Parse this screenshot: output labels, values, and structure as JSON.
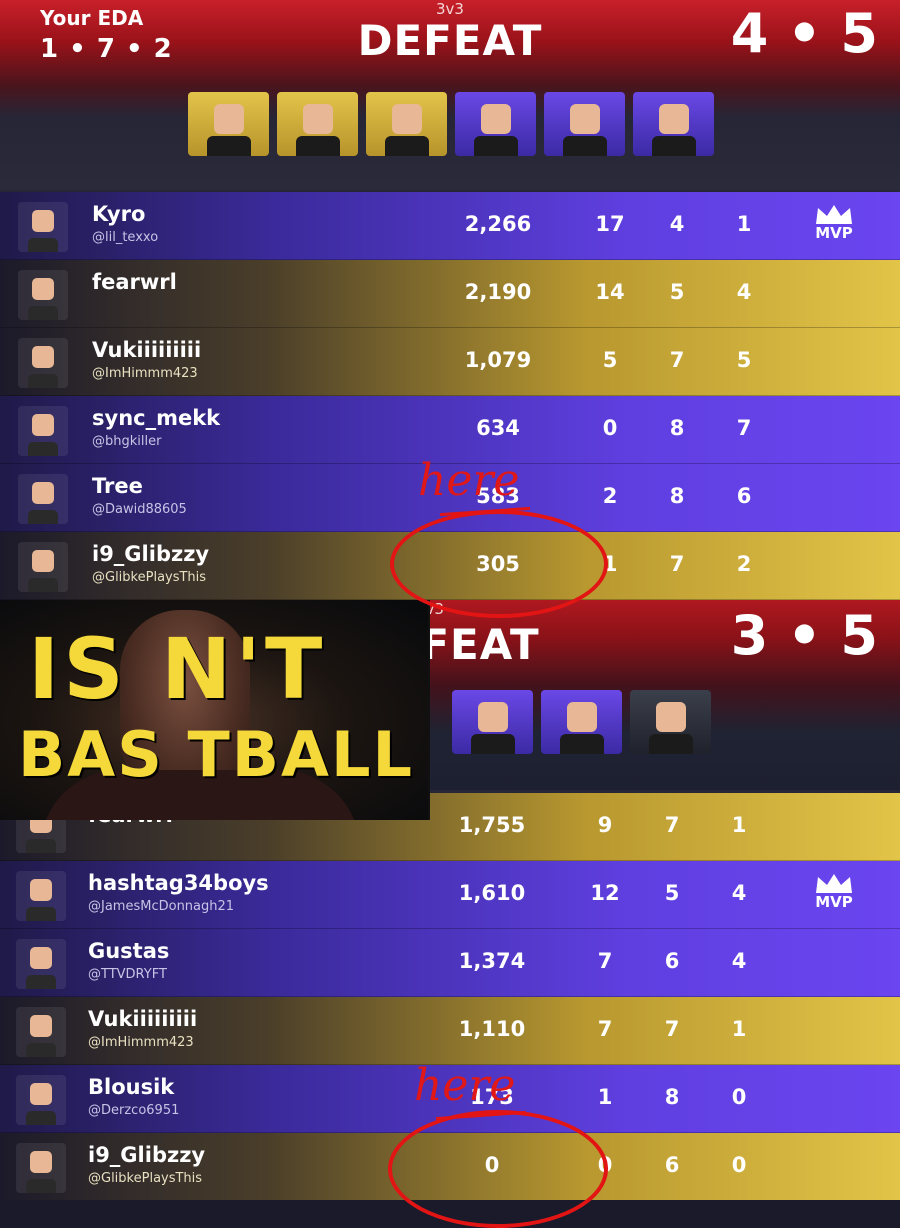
{
  "colors": {
    "banner_red": "#c8202a",
    "row_purple": "#6a45f0",
    "row_gold": "#e2c448",
    "annotation_red": "#e21414",
    "thumb_text": "#f5d93a"
  },
  "match1": {
    "team_label": "Your EDA",
    "team_score": "1 • 7 • 2",
    "mode": "3v3",
    "result": "DEFEAT",
    "score": "4 • 5",
    "avatars": [
      "gold",
      "gold",
      "gold",
      "purple",
      "purple",
      "purple"
    ],
    "rows": [
      {
        "color": "purple",
        "name": "Kyro",
        "handle": "@lil_texxo",
        "points": "2,266",
        "k": "17",
        "d": "4",
        "a": "1",
        "mvp": true
      },
      {
        "color": "gold",
        "name": "fearwrl",
        "handle": "",
        "points": "2,190",
        "k": "14",
        "d": "5",
        "a": "4",
        "mvp": false
      },
      {
        "color": "gold",
        "name": "Vukiiiiiiiii",
        "handle": "@ImHimmm423",
        "points": "1,079",
        "k": "5",
        "d": "7",
        "a": "5",
        "mvp": false
      },
      {
        "color": "purple",
        "name": "sync_mekk",
        "handle": "@bhgkiller",
        "points": "634",
        "k": "0",
        "d": "8",
        "a": "7",
        "mvp": false
      },
      {
        "color": "purple",
        "name": "Tree",
        "handle": "@Dawid88605",
        "points": "583",
        "k": "2",
        "d": "8",
        "a": "6",
        "mvp": false
      },
      {
        "color": "gold",
        "name": "i9_Glibzzy",
        "handle": "@GlibkePlaysThis",
        "points": "305",
        "k": "1",
        "d": "7",
        "a": "2",
        "mvp": false
      }
    ]
  },
  "match2": {
    "mode": "3v3",
    "result": "FEAT",
    "score": "3 • 5",
    "avatars": [
      "purple",
      "purple",
      "dark"
    ],
    "rows": [
      {
        "color": "gold",
        "name": "fearwrl",
        "handle": "",
        "points": "1,755",
        "k": "9",
        "d": "7",
        "a": "1",
        "mvp": false
      },
      {
        "color": "purple",
        "name": "hashtag34boys",
        "handle": "@JamesMcDonnagh21",
        "points": "1,610",
        "k": "12",
        "d": "5",
        "a": "4",
        "mvp": true
      },
      {
        "color": "purple",
        "name": "Gustas",
        "handle": "@TTVDRYFT",
        "points": "1,374",
        "k": "7",
        "d": "6",
        "a": "4",
        "mvp": false
      },
      {
        "color": "gold",
        "name": "Vukiiiiiiiii",
        "handle": "@ImHimmm423",
        "points": "1,110",
        "k": "7",
        "d": "7",
        "a": "1",
        "mvp": false
      },
      {
        "color": "purple",
        "name": "Blousik",
        "handle": "@Derzco6951",
        "points": "173",
        "k": "1",
        "d": "8",
        "a": "0",
        "mvp": false
      },
      {
        "color": "gold",
        "name": "i9_Glibzzy",
        "handle": "@GlibkePlaysThis",
        "points": "0",
        "k": "0",
        "d": "6",
        "a": "0",
        "mvp": false
      }
    ]
  },
  "mvp_label": "MVP",
  "annotation_text": "here",
  "overlay": {
    "line1": "IS N'T",
    "line2": "BAS  TBALL"
  }
}
